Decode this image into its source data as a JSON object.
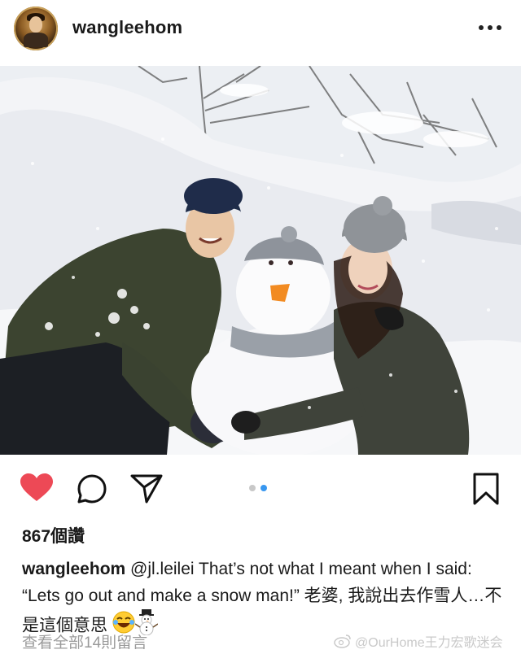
{
  "header": {
    "username": "wangleehom",
    "more_icon": "more-horizontal-icon"
  },
  "photo": {
    "description_icon": "snow-photo"
  },
  "actions": {
    "like_icon": "heart-filled-icon",
    "like_color": "#ed4956",
    "comment_icon": "comment-bubble-icon",
    "share_icon": "paper-plane-icon",
    "save_icon": "bookmark-icon",
    "carousel_active_color": "#3897f0"
  },
  "likes": {
    "text": "867個讚"
  },
  "caption": {
    "username": "wangleehom",
    "mention": "@jl.leilei",
    "text": " That’s not what I meant when I said: “Lets go out and make a snow man!” 老婆, 我說出去作雪人…不是這個意思"
  },
  "comments": {
    "view_all": "查看全部14則留言"
  },
  "watermark": {
    "text": "@OurHome王力宏歌迷会"
  }
}
